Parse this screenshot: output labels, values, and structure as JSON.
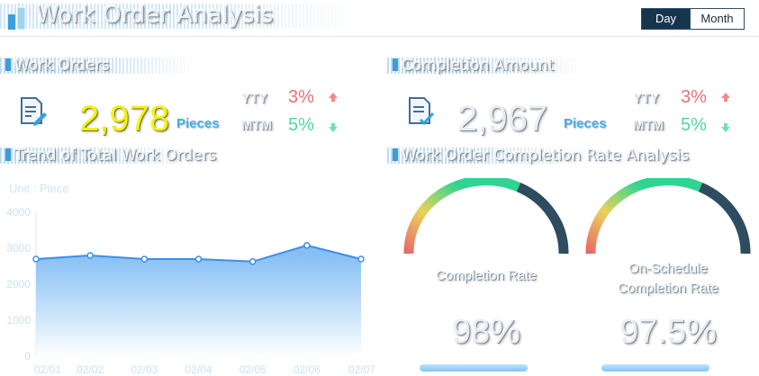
{
  "header": {
    "title": "Work Order Analysis",
    "period_tabs": [
      {
        "label": "Day",
        "active": true
      },
      {
        "label": "Month",
        "active": false
      }
    ]
  },
  "work_orders": {
    "heading": "Work Orders",
    "value": "2,978",
    "unit": "Pieces",
    "yty_label": "YTY",
    "yty_value": "3%",
    "yty_trend": "up",
    "mtm_label": "MTM",
    "mtm_value": "5%",
    "mtm_trend": "down"
  },
  "completion_amount": {
    "heading": "Completion Amount",
    "value": "2,967",
    "unit": "Pieces",
    "yty_label": "YTY",
    "yty_value": "3%",
    "yty_trend": "up",
    "mtm_label": "MTM",
    "mtm_value": "5%",
    "mtm_trend": "down"
  },
  "trend": {
    "heading": "Trend of Total Work Orders",
    "unit_caption": "Unit : Piece"
  },
  "rate_analysis": {
    "heading": "Work Order Completion Rate Analysis",
    "gauges": [
      {
        "label_lines": [
          "Completion Rate"
        ],
        "value_text": "98%",
        "value": 98
      },
      {
        "label_lines": [
          "On-Schedule",
          "Completion Rate"
        ],
        "value_text": "97.5%",
        "value": 97.5
      }
    ]
  },
  "colors": {
    "accent": "#4aaee3",
    "highlight_yellow": "#f3f01e",
    "up_red": "#e8736f",
    "down_green": "#4fd6a3",
    "line_blue": "#3d8ee6",
    "gauge_dark": "#2f4b60"
  },
  "chart_data": {
    "type": "area",
    "title": "Trend of Total Work Orders",
    "ylabel": "Unit : Piece",
    "categories": [
      "02/01",
      "02/02",
      "02/03",
      "02/04",
      "02/05",
      "02/06",
      "02/07"
    ],
    "values": [
      2700,
      2800,
      2700,
      2700,
      2630,
      3080,
      2700
    ],
    "ylim": [
      0,
      4000
    ],
    "yticks": [
      0,
      1000,
      2000,
      3000,
      4000
    ],
    "grid": false
  }
}
